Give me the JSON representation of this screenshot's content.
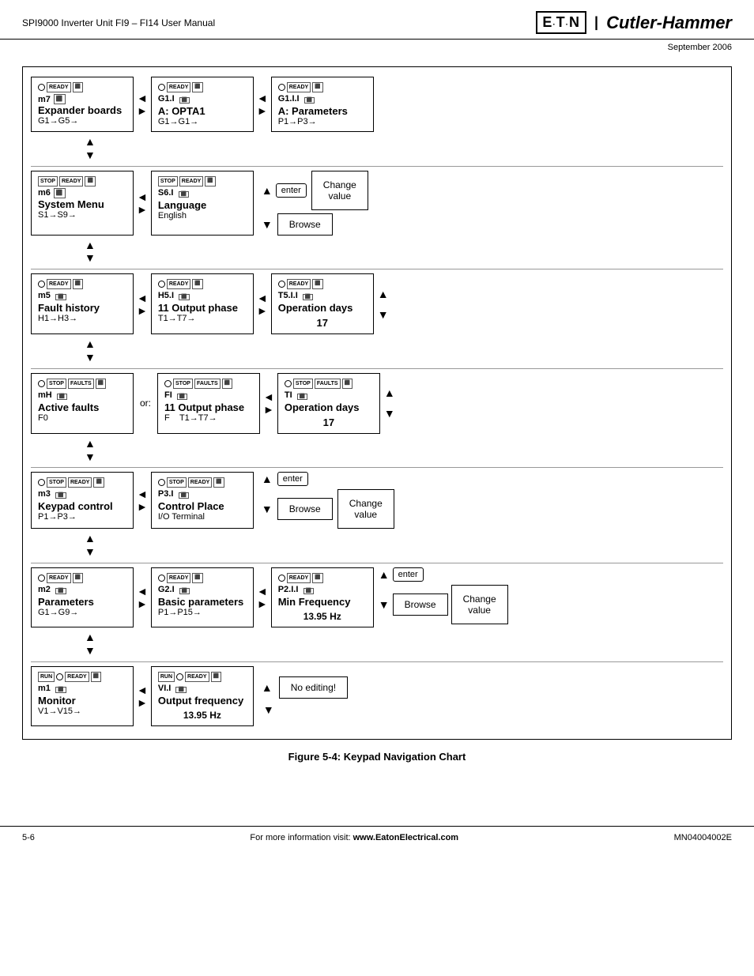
{
  "header": {
    "left": "SPI9000 Inverter Unit FI9 – FI14 User Manual",
    "logo": "E·T·N",
    "brand": "Cutler-Hammer",
    "date": "September 2006"
  },
  "footer": {
    "left": "5-6",
    "center_prefix": "For more information visit: ",
    "center_link": "www.EatonElectrical.com",
    "right": "MN04004002E"
  },
  "figure_caption": "Figure 5-4: Keypad Navigation Chart",
  "rows": [
    {
      "id": "row1",
      "col1": {
        "indicators": [
          "●",
          "READY"
        ],
        "menu_id": "m7",
        "title": "Expander boards",
        "range": "G1→G5→"
      },
      "col2": {
        "indicators": [
          "●",
          "READY"
        ],
        "menu_id": "G1.I",
        "title": "A: OPTA1",
        "range": "G1→G1→"
      },
      "col3": {
        "indicators": [
          "●",
          "READY"
        ],
        "menu_id": "G1.I.I",
        "title": "A: Parameters",
        "range": "P1→P3→"
      }
    },
    {
      "id": "row2",
      "col1": {
        "indicators": [
          "STOP",
          "READY"
        ],
        "menu_id": "m6",
        "title": "System Menu",
        "range": "S1→S9→"
      },
      "col2": {
        "indicators": [
          "STOP",
          "READY"
        ],
        "menu_id": "S6.I",
        "title": "Language",
        "range": "English"
      },
      "col3_special": {
        "change_value": "Change\nvalue",
        "browse": "Browse"
      }
    },
    {
      "id": "row3",
      "col1": {
        "indicators": [
          "●",
          "READY"
        ],
        "menu_id": "m5",
        "title": "Fault history",
        "range": "H1→H3→"
      },
      "col2": {
        "indicators": [
          "●",
          "READY"
        ],
        "menu_id": "H5.I",
        "title": "11 Output phase",
        "range": "T1→T7→"
      },
      "col3": {
        "indicators": [
          "●",
          "READY"
        ],
        "menu_id": "T5.I.I",
        "title": "Operation days",
        "value": "17",
        "has_arrows": true
      }
    },
    {
      "id": "row4",
      "col1": {
        "indicators": [
          "●",
          "STOP",
          "FAULTS"
        ],
        "menu_id": "mH",
        "title": "Active faults",
        "range": "F0"
      },
      "or_label": "or:",
      "col2": {
        "indicators": [
          "●",
          "STOP",
          "FAULTS"
        ],
        "menu_id": "FI",
        "title": "11 Output phase",
        "range": "F    T1→T7→"
      },
      "col3": {
        "indicators": [
          "●",
          "STOP",
          "FAULTS"
        ],
        "menu_id": "TI",
        "title": "Operation days",
        "value": "17",
        "has_arrows": true
      }
    },
    {
      "id": "row5",
      "col1": {
        "indicators": [
          "●",
          "STOP",
          "READY"
        ],
        "menu_id": "m3",
        "title": "Keypad control",
        "range": "P1→P3→"
      },
      "col2": {
        "indicators": [
          "●",
          "STOP",
          "READY"
        ],
        "menu_id": "P3.I",
        "title": "Control Place",
        "range": "I/O Terminal"
      },
      "col3_special2": {
        "enter": "enter",
        "browse": "Browse",
        "change": "Change\nvalue"
      }
    },
    {
      "id": "row6",
      "col1": {
        "indicators": [
          "●",
          "READY"
        ],
        "menu_id": "m2",
        "title": "Parameters",
        "range": "G1→G9→"
      },
      "col2": {
        "indicators": [
          "●",
          "READY"
        ],
        "menu_id": "G2.I",
        "title": "Basic parameters",
        "range": "P1→P15→"
      },
      "col3": {
        "indicators": [
          "●",
          "READY"
        ],
        "menu_id": "P2.I.I",
        "title": "Min Frequency",
        "value": "13.95 Hz",
        "has_enter": true,
        "browse_change": true
      }
    },
    {
      "id": "row7",
      "col1": {
        "indicators": [
          "RUN",
          "●",
          "READY"
        ],
        "menu_id": "m1",
        "title": "Monitor",
        "range": "V1→V15→"
      },
      "col2": {
        "indicators": [
          "RUN",
          "●",
          "READY"
        ],
        "menu_id": "VI.I",
        "title": "Output frequency",
        "range": "13.95 Hz"
      },
      "col3_noedit": {
        "label": "No editing!"
      }
    }
  ]
}
